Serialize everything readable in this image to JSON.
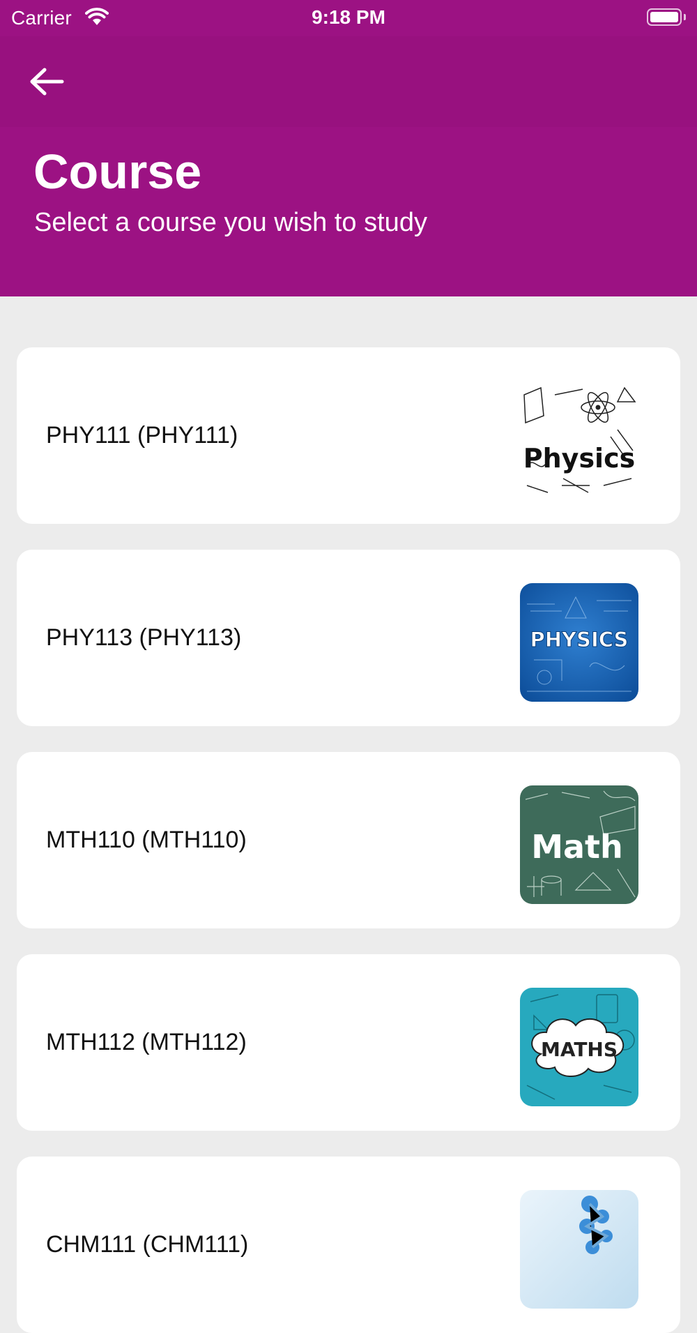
{
  "status_bar": {
    "carrier": "Carrier",
    "time": "9:18 PM"
  },
  "header": {
    "back_icon": "arrow-left-icon",
    "title": "Course",
    "subtitle": "Select a course you wish to study"
  },
  "courses": [
    {
      "label": "PHY111 (PHY111)",
      "thumbnail_text": "Physics",
      "thumbnail_icon": "physics-sketch-image"
    },
    {
      "label": "PHY113 (PHY113)",
      "thumbnail_text": "PHYSICS",
      "thumbnail_icon": "physics-blue-image"
    },
    {
      "label": "MTH110 (MTH110)",
      "thumbnail_text": "Math",
      "thumbnail_icon": "math-chalkboard-image"
    },
    {
      "label": "MTH112 (MTH112)",
      "thumbnail_text": "MATHS",
      "thumbnail_icon": "maths-cloud-image"
    },
    {
      "label": "CHM111 (CHM111)",
      "thumbnail_text": "",
      "thumbnail_icon": "molecule-image"
    }
  ],
  "colors": {
    "header_background": "#9C1283",
    "nav_bar_background": "#98117F",
    "page_background": "#ECECEC",
    "card_background": "#FFFFFF"
  }
}
